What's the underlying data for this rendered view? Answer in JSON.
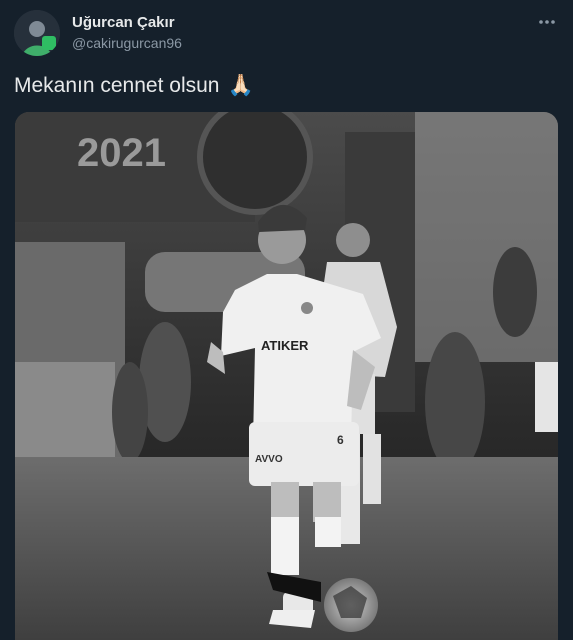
{
  "tweet": {
    "author_name": "Uğurcan Çakır",
    "author_handle": "@cakirugurcan96",
    "text": "Mekanın cennet olsun",
    "emoji": "🙏🏻",
    "icons": {
      "more": "more-dots-icon",
      "emoji": "folded-hands-icon"
    }
  },
  "media": {
    "banner_text": "2021",
    "jersey_sponsor": "ATIKER",
    "shorts_text": "AVVO",
    "shirt_number": "6",
    "style": "black-and-white photo"
  },
  "colors": {
    "background": "#15202b",
    "name": "#e7e9ea",
    "handle": "#8b98a5"
  }
}
